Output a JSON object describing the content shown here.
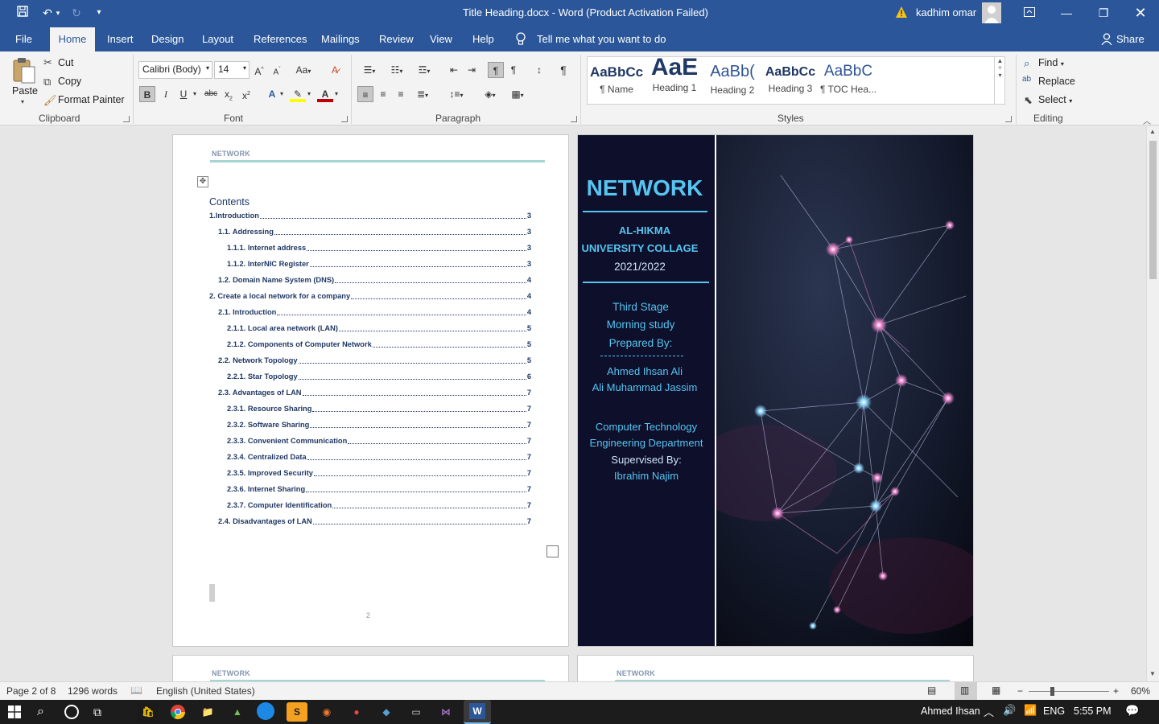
{
  "window": {
    "title": "Title Heading.docx  -  Word (Product Activation Failed)",
    "user": "kadhim omar",
    "warning_icon": "warning-icon"
  },
  "qat": {
    "save": "save-icon",
    "undo": "undo-icon",
    "redo": "redo-icon",
    "customize": "▾"
  },
  "tabs": [
    {
      "label": "File"
    },
    {
      "label": "Home"
    },
    {
      "label": "Insert"
    },
    {
      "label": "Design"
    },
    {
      "label": "Layout"
    },
    {
      "label": "References"
    },
    {
      "label": "Mailings"
    },
    {
      "label": "Review"
    },
    {
      "label": "View"
    },
    {
      "label": "Help"
    }
  ],
  "tell_me": "Tell me what you want to do",
  "share": "Share",
  "clipboard": {
    "paste": "Paste",
    "cut": "Cut",
    "copy": "Copy",
    "format_painter": "Format Painter",
    "label": "Clipboard"
  },
  "font": {
    "family": "Calibri (Body)",
    "size": "14",
    "label": "Font",
    "change_case": "Aa"
  },
  "paragraph": {
    "label": "Paragraph"
  },
  "styles": {
    "label": "Styles",
    "items": [
      {
        "preview": "AaBbCc",
        "name": "¶ Name"
      },
      {
        "preview": "AaE",
        "name": "Heading 1"
      },
      {
        "preview": "AaBb(",
        "name": "Heading 2"
      },
      {
        "preview": "AaBbCc",
        "name": "Heading 3"
      },
      {
        "preview": "AaBbC",
        "name": "¶ TOC Hea..."
      }
    ]
  },
  "editing": {
    "label": "Editing",
    "find": "Find",
    "replace": "Replace",
    "select": "Select"
  },
  "document": {
    "header_text": "NETWORK",
    "contents_title": "Contents",
    "page_number": "2",
    "toc": [
      {
        "label": "1.Introduction",
        "page": "3",
        "level": 0
      },
      {
        "label": "1.1. Addressing",
        "page": "3",
        "level": 1
      },
      {
        "label": "1.1.1. Internet address",
        "page": "3",
        "level": 2
      },
      {
        "label": "1.1.2. InterNIC Register",
        "page": "3",
        "level": 2
      },
      {
        "label": "1.2. Domain Name System (DNS)",
        "page": "4",
        "level": 1
      },
      {
        "label": "2. Create a local network for a company",
        "page": "4",
        "level": 0
      },
      {
        "label": "2.1. Introduction",
        "page": "4",
        "level": 1
      },
      {
        "label": "2.1.1. Local area network (LAN)",
        "page": "5",
        "level": 2
      },
      {
        "label": "2.1.2. Components of Computer Network",
        "page": "5",
        "level": 2
      },
      {
        "label": "2.2. Network Topology",
        "page": "5",
        "level": 1
      },
      {
        "label": "2.2.1. Star Topology",
        "page": "6",
        "level": 2
      },
      {
        "label": "2.3. Advantages of LAN",
        "page": "7",
        "level": 1
      },
      {
        "label": "2.3.1. Resource Sharing",
        "page": "7",
        "level": 2
      },
      {
        "label": "2.3.2. Software Sharing",
        "page": "7",
        "level": 2
      },
      {
        "label": "2.3.3. Convenient Communication",
        "page": "7",
        "level": 2
      },
      {
        "label": "2.3.4. Centralized Data",
        "page": "7",
        "level": 2
      },
      {
        "label": "2.3.5. Improved Security",
        "page": "7",
        "level": 2
      },
      {
        "label": "2.3.6. Internet Sharing",
        "page": "7",
        "level": 2
      },
      {
        "label": "2.3.7. Computer Identification",
        "page": "7",
        "level": 2
      },
      {
        "label": "2.4. Disadvantages of LAN",
        "page": "7",
        "level": 1
      }
    ],
    "cover": {
      "title": "NETWORK",
      "uni1": "AL-HIKMA",
      "uni2": "UNIVERSITY COLLAGE",
      "year": "2021/2022",
      "stage": "Third Stage",
      "study": "Morning study",
      "prepared": "Prepared By:",
      "author1": "Ahmed Ihsan Ali",
      "author2": "Ali Muhammad Jassim",
      "dept1": "Computer Technology",
      "dept2": "Engineering Department",
      "supervised": "Supervised By:",
      "supervisor": "Ibrahim Najim"
    }
  },
  "status": {
    "page": "Page 2 of 8",
    "words": "1296 words",
    "language": "English (United States)",
    "zoom": "60%"
  },
  "taskbar": {
    "user": "Ahmed Ihsan",
    "lang": "ENG",
    "time": "5:55 PM"
  }
}
